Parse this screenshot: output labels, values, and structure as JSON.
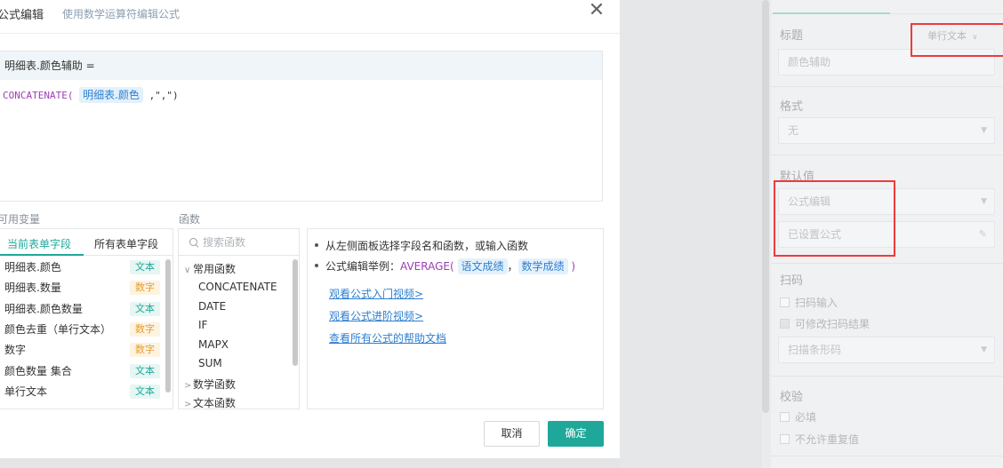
{
  "dialog": {
    "title": "公式编辑",
    "subtitle": "使用数学运算符编辑公式",
    "close_icon": "close-icon"
  },
  "editor": {
    "field_name": "明细表.颜色辅助 =",
    "formula_fn": "CONCATENATE(",
    "formula_arg": "明细表.颜色",
    "formula_rest": ",\",\")"
  },
  "variables": {
    "section_label": "可用变量",
    "tabs": [
      "当前表单字段",
      "所有表单字段"
    ],
    "items": [
      {
        "name": "明细表.颜色",
        "type": "文本",
        "kind": "text"
      },
      {
        "name": "明细表.数量",
        "type": "数字",
        "kind": "num"
      },
      {
        "name": "明细表.颜色数量",
        "type": "文本",
        "kind": "text"
      },
      {
        "name": "颜色去重（单行文本）",
        "type": "数字",
        "kind": "num"
      },
      {
        "name": "数字",
        "type": "数字",
        "kind": "num"
      },
      {
        "name": "颜色数量 集合",
        "type": "文本",
        "kind": "text"
      },
      {
        "name": "单行文本",
        "type": "文本",
        "kind": "text"
      }
    ]
  },
  "functions": {
    "section_label": "函数",
    "search_placeholder": "搜索函数",
    "groups": [
      {
        "name": "常用函数",
        "expanded": true
      },
      {
        "name": "数学函数",
        "expanded": false
      },
      {
        "name": "文本函数",
        "expanded": false
      }
    ],
    "common": [
      "CONCATENATE",
      "DATE",
      "IF",
      "MAPX",
      "SUM"
    ]
  },
  "help": {
    "line1": "从左侧面板选择字段名和函数，或输入函数",
    "line2_prefix": "公式编辑举例：",
    "line2_fn": "AVERAGE(",
    "line2_arg1": "语文成绩",
    "line2_sep": "，",
    "line2_arg2": "数学成绩",
    "line2_end": ")",
    "links": [
      "观看公式入门视频>",
      "观看公式进阶视频>",
      "查看所有公式的帮助文档"
    ]
  },
  "buttons": {
    "cancel": "取消",
    "ok": "确定"
  },
  "panel": {
    "title_label": "标题",
    "title_type": "单行文本",
    "title_value": "颜色辅助",
    "format_label": "格式",
    "format_value": "无",
    "default_label": "默认值",
    "default_mode": "公式编辑",
    "default_status": "已设置公式",
    "scan_label": "扫码",
    "scan_input": "扫码输入",
    "scan_modify": "可修改扫码结果",
    "scan_type": "扫描条形码",
    "validate_label": "校验",
    "required": "必填",
    "no_duplicate": "不允许重复值"
  },
  "colors": {
    "accent": "#1fa89a",
    "highlight_box": "#ee3b3b",
    "link": "#2e7fd0",
    "function": "#9b3fb3"
  }
}
